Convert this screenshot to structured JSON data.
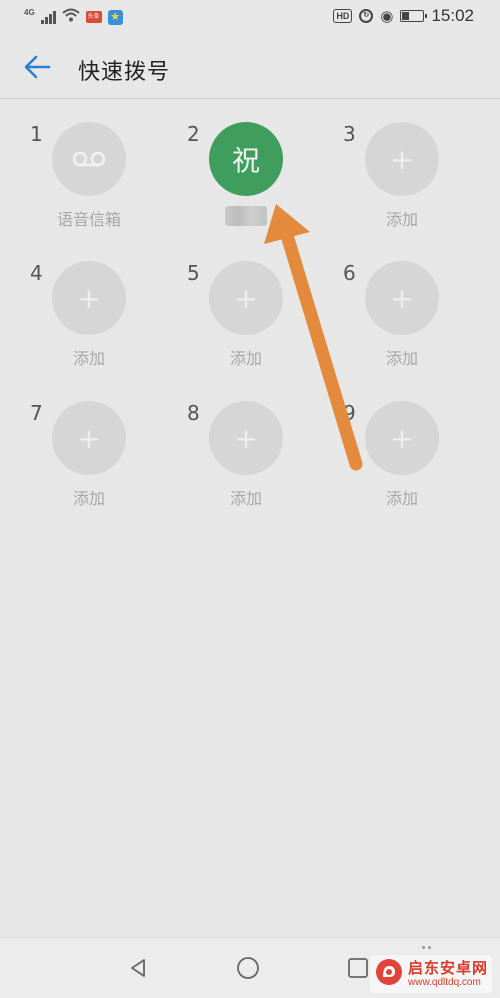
{
  "status_bar": {
    "network_label": "4G",
    "time": "15:02",
    "hd_label": "HD",
    "battery_level": 0.35,
    "red_badge_text": "头条",
    "icons": [
      "signal-icon",
      "wifi-icon",
      "news-app-icon",
      "star-app-icon",
      "hd-icon",
      "sync-icon",
      "eye-protect-icon",
      "battery-icon"
    ]
  },
  "header": {
    "back_icon": "back-arrow-icon",
    "title": "快速拨号"
  },
  "speed_dial": {
    "slots": [
      {
        "number": "1",
        "label": "语音信箱",
        "icon": "voicemail-icon",
        "state": "voicemail"
      },
      {
        "number": "2",
        "label": "",
        "avatar_text": "祝",
        "state": "assigned"
      },
      {
        "number": "3",
        "label": "添加",
        "icon": "plus-icon",
        "state": "empty"
      },
      {
        "number": "4",
        "label": "添加",
        "icon": "plus-icon",
        "state": "empty"
      },
      {
        "number": "5",
        "label": "添加",
        "icon": "plus-icon",
        "state": "empty"
      },
      {
        "number": "6",
        "label": "添加",
        "icon": "plus-icon",
        "state": "empty"
      },
      {
        "number": "7",
        "label": "添加",
        "icon": "plus-icon",
        "state": "empty"
      },
      {
        "number": "8",
        "label": "添加",
        "icon": "plus-icon",
        "state": "empty"
      },
      {
        "number": "9",
        "label": "添加",
        "icon": "plus-icon",
        "state": "empty"
      }
    ],
    "plus_glyph": "+",
    "avatar_color": "#3f9e5e",
    "empty_circle_color": "#d6d6d6"
  },
  "annotation": {
    "arrow_color": "#e48a3c"
  },
  "nav_bar": {
    "icons": [
      "back-triangle-icon",
      "home-circle-icon",
      "recents-square-icon"
    ]
  },
  "watermark": {
    "text": "启东安卓网",
    "url": "www.qdltdq.com"
  }
}
